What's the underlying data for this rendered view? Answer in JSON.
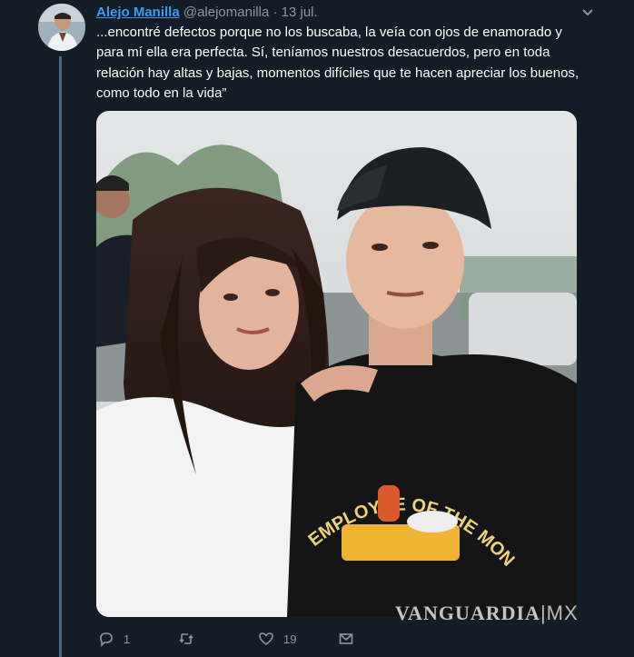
{
  "tweet": {
    "author_name": "Alejo Manilla",
    "author_handle": "@alejomanilla",
    "separator": "·",
    "date": "13 jul.",
    "text": "...encontré defectos porque no los buscaba, la veía con ojos de enamorado y para mí ella era perfecta. Sí, teníamos nuestros desacuerdos, pero en toda relación hay altas y bajas, momentos difíciles que te hacen apreciar los buenos, como todo en la vida”",
    "photo_shirt_text": "EMPLOYEE OF THE MONTH",
    "actions": {
      "replies": "1",
      "retweets": "",
      "likes": "19"
    }
  },
  "watermark": {
    "brand": "VANGUARDIA",
    "suffix": "MX"
  },
  "colors": {
    "background": "#141d26",
    "link": "#3d9bf0",
    "muted": "#8899a6",
    "thread_line": "#3b6a9a"
  },
  "icons": [
    "chevron-down-icon",
    "reply-icon",
    "retweet-icon",
    "like-icon",
    "dm-icon"
  ]
}
